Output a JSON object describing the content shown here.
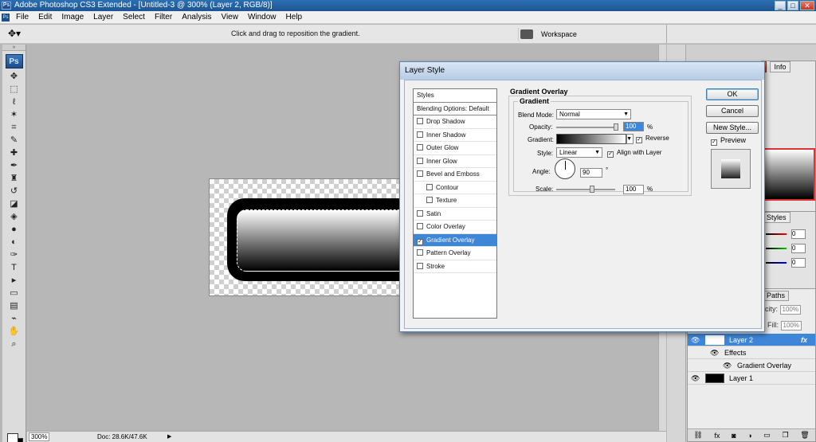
{
  "app": {
    "title": "Adobe Photoshop CS3 Extended - [Untitled-3 @ 300% (Layer 2, RGB/8)]",
    "logo": "Ps",
    "menu": [
      "File",
      "Edit",
      "Image",
      "Layer",
      "Select",
      "Filter",
      "Analysis",
      "View",
      "Window",
      "Help"
    ]
  },
  "options": {
    "hint": "Click and drag to reposition the gradient.",
    "workspace_label": "Workspace"
  },
  "status": {
    "zoom": "300%",
    "doc": "Doc: 28.6K/47.6K"
  },
  "dialog": {
    "title": "Layer Style",
    "styles_header": "Styles",
    "blending_options": "Blending Options: Default",
    "styles": [
      {
        "label": "Drop Shadow",
        "checked": false,
        "indent": false
      },
      {
        "label": "Inner Shadow",
        "checked": false,
        "indent": false
      },
      {
        "label": "Outer Glow",
        "checked": false,
        "indent": false
      },
      {
        "label": "Inner Glow",
        "checked": false,
        "indent": false
      },
      {
        "label": "Bevel and Emboss",
        "checked": false,
        "indent": false
      },
      {
        "label": "Contour",
        "checked": false,
        "indent": true
      },
      {
        "label": "Texture",
        "checked": false,
        "indent": true
      },
      {
        "label": "Satin",
        "checked": false,
        "indent": false
      },
      {
        "label": "Color Overlay",
        "checked": false,
        "indent": false
      },
      {
        "label": "Gradient Overlay",
        "checked": true,
        "indent": false
      },
      {
        "label": "Pattern Overlay",
        "checked": false,
        "indent": false
      },
      {
        "label": "Stroke",
        "checked": false,
        "indent": false
      }
    ],
    "section_title": "Gradient Overlay",
    "subsection_title": "Gradient",
    "blend_mode_label": "Blend Mode:",
    "blend_mode_value": "Normal",
    "opacity_label": "Opacity:",
    "opacity_value": "100",
    "percent": "%",
    "gradient_label": "Gradient:",
    "reverse_label": "Reverse",
    "reverse_checked": true,
    "style_label": "Style:",
    "style_value": "Linear",
    "align_label": "Align with Layer",
    "align_checked": true,
    "angle_label": "Angle:",
    "angle_value": "90",
    "degree": "°",
    "scale_label": "Scale:",
    "scale_value": "100",
    "ok_label": "OK",
    "cancel_label": "Cancel",
    "new_style_label": "New Style...",
    "preview_label": "Preview",
    "preview_checked": true
  },
  "panels": {
    "info_tab": "Info",
    "styles_tab": "Styles",
    "paths_tab": "Paths",
    "opacity_label": "Opacity:",
    "opacity_value": "100%",
    "fill_label": "Fill:",
    "fill_value": "100%",
    "color_values": [
      "0",
      "0",
      "0"
    ],
    "layers": [
      {
        "name": "Layer 2",
        "selected": true,
        "fx": "fx"
      },
      {
        "name": "Effects",
        "sub": true
      },
      {
        "name": "Gradient Overlay",
        "sub": true
      },
      {
        "name": "Layer 1",
        "selected": false
      }
    ],
    "bottom_icons": [
      "link-icon",
      "fx-icon",
      "mask-icon",
      "adjustment-icon",
      "folder-icon",
      "new-layer-icon",
      "trash-icon"
    ]
  },
  "colors": {
    "accent": "#3d86d8",
    "title_bar": "#2b6fb4"
  }
}
